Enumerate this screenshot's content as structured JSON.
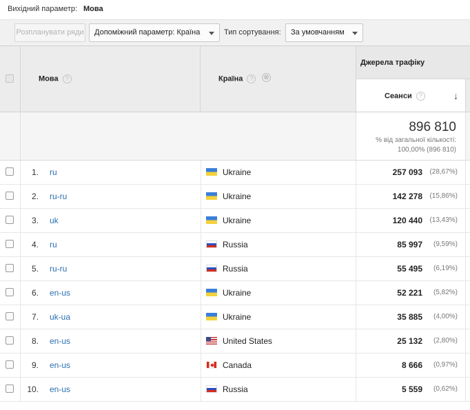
{
  "topbar": {
    "primary_label": "Вихідний параметр:",
    "primary_value": "Мова"
  },
  "toolbar": {
    "pivot_button": "Розпланувати ряди",
    "secondary_dimension": "Допоміжний параметр: Країна",
    "sort_label": "Тип сортування:",
    "sort_value": "За умовчанням"
  },
  "table": {
    "col_language": "Мова",
    "col_country": "Країна",
    "group_header": "Джерела трафіку",
    "col_sessions": "Сеанси",
    "help_glyph": "?",
    "remove_glyph": "⊗",
    "sort_arrow": "↓",
    "total": {
      "value": "896 810",
      "pct_label": "% від загальної кількості:",
      "pct_value": "100,00% (896 810)"
    },
    "rows": [
      {
        "idx": "1.",
        "lang": "ru",
        "flag": "ua",
        "country": "Ukraine",
        "sessions": "257 093",
        "pct": "(28,67%)"
      },
      {
        "idx": "2.",
        "lang": "ru-ru",
        "flag": "ua",
        "country": "Ukraine",
        "sessions": "142 278",
        "pct": "(15,86%)"
      },
      {
        "idx": "3.",
        "lang": "uk",
        "flag": "ua",
        "country": "Ukraine",
        "sessions": "120 440",
        "pct": "(13,43%)"
      },
      {
        "idx": "4.",
        "lang": "ru",
        "flag": "ru",
        "country": "Russia",
        "sessions": "85 997",
        "pct": "(9,59%)"
      },
      {
        "idx": "5.",
        "lang": "ru-ru",
        "flag": "ru",
        "country": "Russia",
        "sessions": "55 495",
        "pct": "(6,19%)"
      },
      {
        "idx": "6.",
        "lang": "en-us",
        "flag": "ua",
        "country": "Ukraine",
        "sessions": "52 221",
        "pct": "(5,82%)"
      },
      {
        "idx": "7.",
        "lang": "uk-ua",
        "flag": "ua",
        "country": "Ukraine",
        "sessions": "35 885",
        "pct": "(4,00%)"
      },
      {
        "idx": "8.",
        "lang": "en-us",
        "flag": "us",
        "country": "United States",
        "sessions": "25 132",
        "pct": "(2,80%)"
      },
      {
        "idx": "9.",
        "lang": "en-us",
        "flag": "ca",
        "country": "Canada",
        "sessions": "8 666",
        "pct": "(0,97%)"
      },
      {
        "idx": "10.",
        "lang": "en-us",
        "flag": "ru",
        "country": "Russia",
        "sessions": "5 559",
        "pct": "(0,62%)"
      }
    ]
  },
  "colors": {
    "link": "#2a6fb0",
    "header_bg": "#ececec",
    "toolbar_bg": "#f1f1f1"
  }
}
